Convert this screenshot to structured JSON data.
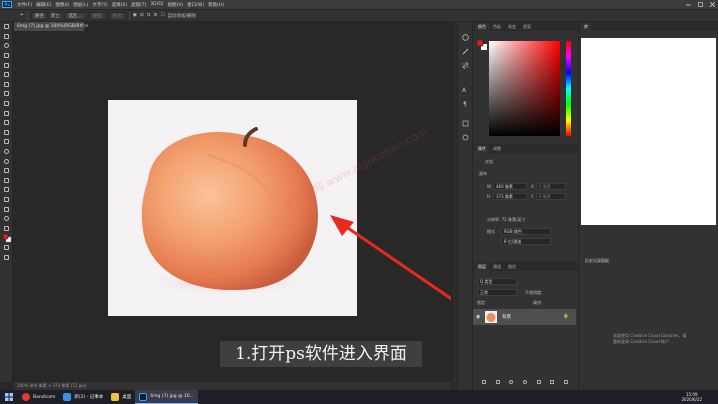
{
  "menubar": {
    "logo": "Ps",
    "items": [
      "文件(F)",
      "编辑(E)",
      "图像(I)",
      "图层(L)",
      "文字(Y)",
      "选择(S)",
      "滤镜(T)",
      "3D(D)",
      "视图(V)",
      "窗口(W)",
      "帮助(H)"
    ],
    "window_controls": [
      "minimize-icon",
      "maximize-icon",
      "close-icon"
    ]
  },
  "optbar": {
    "mode": "新建",
    "mode_alt": "新建",
    "item1": "路径",
    "item2": "建立:",
    "item3": "选区...",
    "item4": "蒙版",
    "item5": "形状",
    "auto": "自动添加/删除"
  },
  "document": {
    "tab_title": "6mg (7).jpg @ 100%(RGB/8#)",
    "tab_close": "×",
    "status": "100%  460 像素 × 373 像素 (72 ppi)",
    "watermark": "爱果栈网 www.aiguozhan.com"
  },
  "caption": "1.打开ps软件进入界面",
  "color_panel": {
    "tabs": [
      "颜色",
      "色板",
      "渐变",
      "图案"
    ],
    "accent": "#ff0000"
  },
  "properties_panel": {
    "tabs": [
      "属性",
      "调整"
    ],
    "doc_label": "文档",
    "section": "画布",
    "w_label": "W",
    "w_value": "460 像素",
    "h_label": "H",
    "h_value": "373 像素",
    "x_label": "X",
    "y_label": "Y",
    "x_value": "0 像素",
    "y_value": "0 像素",
    "resolution": "分辨率: 72 像素/英寸",
    "mode_label": "模式",
    "mode_value": "RGB 颜色",
    "depth_value": "8 位/通道"
  },
  "layers_panel": {
    "tabs": [
      "图层",
      "通道",
      "路径"
    ],
    "search_placeholder": "Q 类型",
    "blend": "正常",
    "opacity_label": "不透明度:",
    "lock_label": "锁定:",
    "fill_label": "填充:",
    "layer_name": "背景"
  },
  "libraries_panel": {
    "tabs": [
      "库"
    ],
    "title": "历史记录面板",
    "msg1": "若要使用 Creative Cloud Libraries，请",
    "msg2": "重新登录 Creative Cloud 帐户"
  },
  "taskbar": {
    "items": [
      {
        "label": "Bandicam",
        "color": "#e03c28"
      },
      {
        "label": "新(2) - 记事本",
        "color": "#3b8ee8"
      },
      {
        "label": "桌面",
        "color": "#f0c040"
      },
      {
        "label": "6mg (7).jpg @ 10...",
        "color": "#31a8ff"
      }
    ],
    "time": "15:09",
    "date": "2020/6/22"
  }
}
